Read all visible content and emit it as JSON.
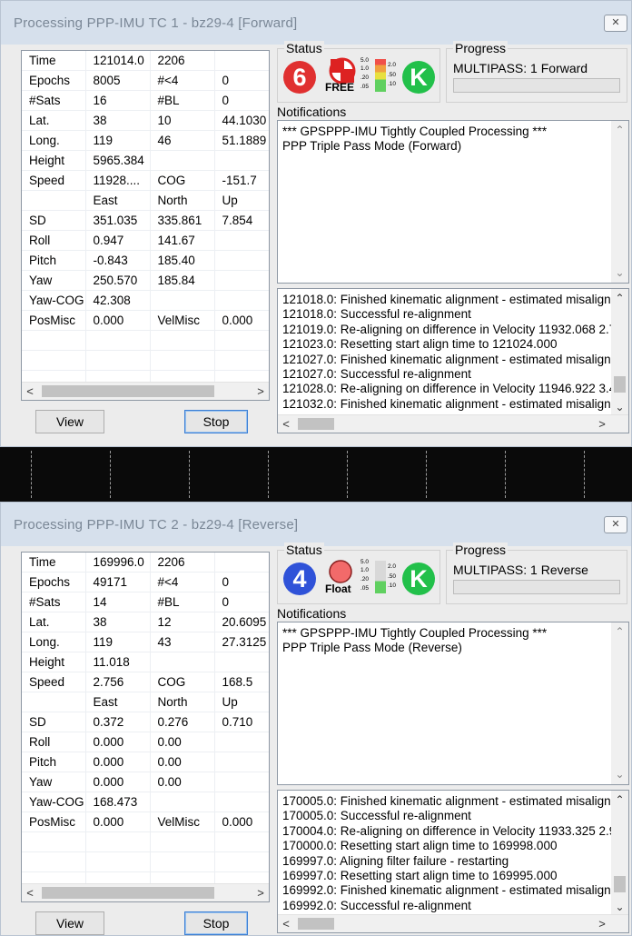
{
  "windows": [
    {
      "title": "Processing PPP-IMU TC 1 - bz29-4 [Forward]",
      "close_glyph": "✕",
      "close_icon": "close-icon",
      "rows": [
        [
          "Time",
          "121014.0",
          "2206",
          ""
        ],
        [
          "Epochs",
          "8005",
          "#<4",
          "0"
        ],
        [
          "#Sats",
          "16",
          "#BL",
          "0"
        ],
        [
          "Lat.",
          "38",
          "10",
          "44.1030"
        ],
        [
          "Long.",
          "119",
          "46",
          "51.1889"
        ],
        [
          "Height",
          "5965.384",
          "",
          ""
        ],
        [
          "Speed",
          "11928....",
          "COG",
          "-151.7"
        ],
        [
          "",
          "East",
          "North",
          "Up"
        ],
        [
          "SD",
          "351.035",
          "335.861",
          "7.854"
        ],
        [
          "Roll",
          "0.947",
          "141.67",
          ""
        ],
        [
          "Pitch",
          "-0.843",
          "185.40",
          ""
        ],
        [
          "Yaw",
          "250.570",
          "185.84",
          ""
        ],
        [
          "Yaw-COG",
          "42.308",
          "",
          ""
        ],
        [
          "PosMisc",
          "0.000",
          "VelMisc",
          "0.000"
        ],
        [
          "",
          "",
          "",
          ""
        ],
        [
          "",
          "",
          "",
          ""
        ],
        [
          "",
          "",
          "",
          ""
        ]
      ],
      "view_label": "View",
      "stop_label": "Stop",
      "status_label": "Status",
      "status_sats": "6",
      "status_sats_color": "#e03030",
      "status_mode": "FREE",
      "status_mode_icon": "fixed-crosshair-icon",
      "status_filter": "K",
      "status_filter_color": "#22c04a",
      "quality_labels": [
        "5.0",
        "1.0",
        ".20",
        ".05",
        "2.0",
        ".50",
        ".10"
      ],
      "progress_label": "Progress",
      "progress_text": "MULTIPASS: 1  Forward",
      "progress_value": 0,
      "notifications_label": "Notifications",
      "notifications": [
        "*** GPSPPP-IMU Tightly Coupled Processing ***",
        "PPP Triple Pass Mode (Forward)"
      ],
      "log": [
        "121018.0: Finished kinematic alignment - estimated misalign e",
        "121018.0: Successful re-alignment",
        "121019.0: Re-aligning on difference in Velocity 11932.068 2.7",
        "121023.0: Resetting start align time to 121024.000",
        "121027.0: Finished kinematic alignment - estimated misalign e",
        "121027.0: Successful re-alignment",
        "121028.0: Re-aligning on difference in Velocity 11946.922 3.4",
        "121032.0: Finished kinematic alignment - estimated misalign e"
      ]
    },
    {
      "title": "Processing PPP-IMU TC 2 - bz29-4 [Reverse]",
      "close_glyph": "✕",
      "close_icon": "close-icon",
      "rows": [
        [
          "Time",
          "169996.0",
          "2206",
          ""
        ],
        [
          "Epochs",
          "49171",
          "#<4",
          "0"
        ],
        [
          "#Sats",
          "14",
          "#BL",
          "0"
        ],
        [
          "Lat.",
          "38",
          "12",
          "20.6095"
        ],
        [
          "Long.",
          "119",
          "43",
          "27.3125"
        ],
        [
          "Height",
          "11.018",
          "",
          ""
        ],
        [
          "Speed",
          "2.756",
          "COG",
          "168.5"
        ],
        [
          "",
          "East",
          "North",
          "Up"
        ],
        [
          "SD",
          "0.372",
          "0.276",
          "0.710"
        ],
        [
          "Roll",
          "0.000",
          "0.00",
          ""
        ],
        [
          "Pitch",
          "0.000",
          "0.00",
          ""
        ],
        [
          "Yaw",
          "0.000",
          "0.00",
          ""
        ],
        [
          "Yaw-COG",
          "168.473",
          "",
          ""
        ],
        [
          "PosMisc",
          "0.000",
          "VelMisc",
          "0.000"
        ],
        [
          "",
          "",
          "",
          ""
        ],
        [
          "",
          "",
          "",
          ""
        ],
        [
          "",
          "",
          "",
          ""
        ]
      ],
      "view_label": "View",
      "stop_label": "Stop",
      "status_label": "Status",
      "status_sats": "4",
      "status_sats_color": "#2f52d8",
      "status_mode": "Float",
      "status_mode_icon": "float-red-circle-icon",
      "status_filter": "K",
      "status_filter_color": "#22c04a",
      "quality_labels": [
        "5.0",
        "1.0",
        ".20",
        ".05",
        "2.0",
        ".50",
        ".10"
      ],
      "progress_label": "Progress",
      "progress_text": "MULTIPASS: 1  Reverse",
      "progress_value": 0,
      "notifications_label": "Notifications",
      "notifications": [
        "*** GPSPPP-IMU Tightly Coupled Processing ***",
        "PPP Triple Pass Mode (Reverse)"
      ],
      "log": [
        "170005.0: Finished kinematic alignment - estimated misalign e",
        "170005.0: Successful re-alignment",
        "170004.0: Re-aligning on difference in Velocity 11933.325 2.9",
        "170000.0: Resetting start align time to 169998.000",
        "169997.0: Aligning filter failure - restarting",
        "169997.0: Resetting start align time to 169995.000",
        "169992.0: Finished kinematic alignment - estimated misalign e",
        "169992.0: Successful re-alignment"
      ]
    }
  ],
  "scroll_icons": {
    "left": "◀",
    "right": "▶",
    "up": "▲",
    "down": "▼"
  }
}
